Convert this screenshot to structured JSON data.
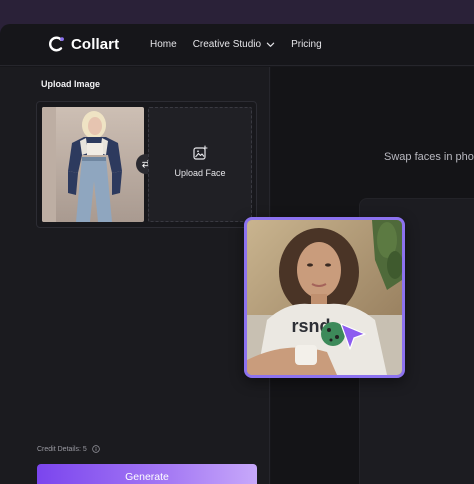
{
  "app": {
    "logo_text": "Collart",
    "nav": [
      {
        "label": "Home"
      },
      {
        "label": "Creative Studio",
        "has_dropdown": true
      },
      {
        "label": "Pricing"
      }
    ]
  },
  "upload": {
    "title": "Upload Image",
    "face_label": "Upload Face"
  },
  "credits": {
    "label": "Credit Details: 5"
  },
  "generate_label": "Generate",
  "preview": {
    "hint_text": "Swap faces in pho"
  },
  "face_card": {
    "shirt_text": "rsnd"
  },
  "colors": {
    "accent": "#8c72ef",
    "button_start": "#7b45ee",
    "button_end": "#c7a8fa",
    "background": "#16161a",
    "frame": "#2a2138"
  }
}
